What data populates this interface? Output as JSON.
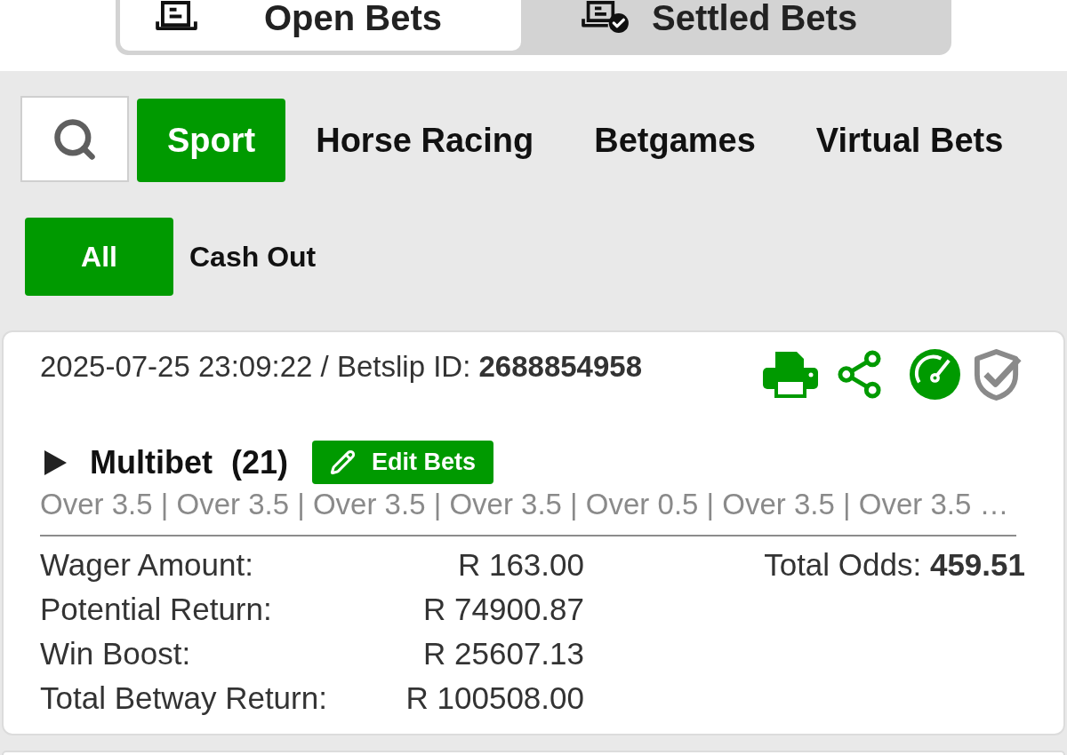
{
  "bet_type_tabs": [
    {
      "label": "Open Bets",
      "selected": true
    },
    {
      "label": "Settled Bets",
      "selected": false
    }
  ],
  "category_tabs": [
    {
      "label": "Sport",
      "selected": true
    },
    {
      "label": "Horse Racing",
      "selected": false
    },
    {
      "label": "Betgames",
      "selected": false
    },
    {
      "label": "Virtual Bets",
      "selected": false
    }
  ],
  "filter_tabs": [
    {
      "label": "All",
      "selected": true
    },
    {
      "label": "Cash Out",
      "selected": false
    }
  ],
  "bet_card": {
    "header": "2025-07-25 23:09:22 / Betslip ID: **2688854958**",
    "expanded": false,
    "bet_type": "Multibet",
    "leg_count": "(21)",
    "edit_button": "Edit Bets",
    "selections": "Over 3.5 | Over 3.5 | Over 3.5 | Over 3.5 | Over 0.5 | Over 3.5 | Over 3.5 …",
    "summary": [
      {
        "label": "Wager Amount:",
        "value": "R 163.00"
      },
      {
        "label": "Potential Return:",
        "value": "R 74900.87"
      },
      {
        "label": "Win Boost:",
        "value": "R 25607.13"
      },
      {
        "label": "Total Betway Return:",
        "value": "R 100508.00"
      }
    ],
    "total_odds": "Total Odds: **459.51**"
  }
}
